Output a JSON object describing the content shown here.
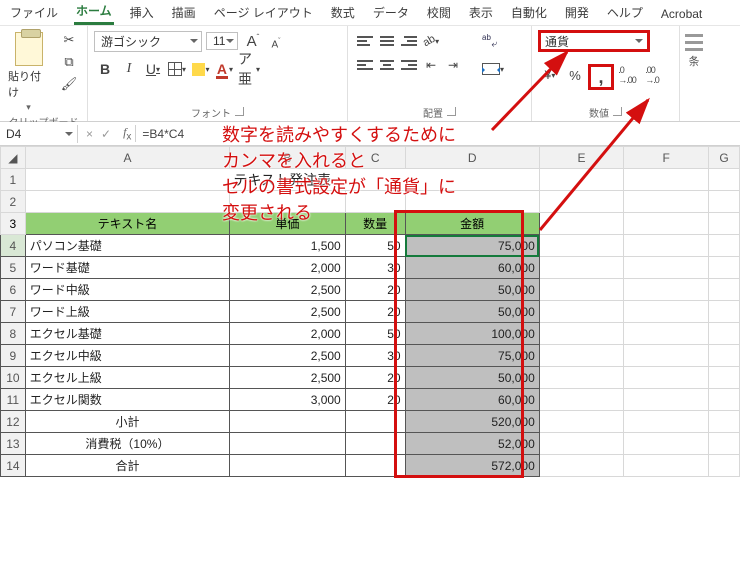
{
  "menubar": {
    "items": [
      "ファイル",
      "ホーム",
      "挿入",
      "描画",
      "ページ レイアウト",
      "数式",
      "データ",
      "校閲",
      "表示",
      "自動化",
      "開発",
      "ヘルプ",
      "Acrobat"
    ],
    "active": 1
  },
  "ribbon": {
    "clipboard": {
      "paste": "貼り付け",
      "group": "クリップボード"
    },
    "font": {
      "name": "游ゴシック",
      "size": "11",
      "group": "フォント"
    },
    "alignment": {
      "group": "配置"
    },
    "number": {
      "format": "通貨",
      "group": "数値"
    },
    "styles": {
      "group": "条"
    }
  },
  "fxbar": {
    "namebox": "D4",
    "formula": "=B4*C4"
  },
  "annotation": {
    "l1": "数字を読みやすくするために",
    "l2": "カンマを入れると",
    "l3": "セルの書式設定が「通貨」に",
    "l4": "変更される"
  },
  "sheet": {
    "cols": [
      "A",
      "B",
      "C",
      "D",
      "E",
      "F",
      "G"
    ],
    "title": "テキスト発注表",
    "headers": {
      "a": "テキスト名",
      "b": "単価",
      "c": "数量",
      "d": "金額"
    },
    "rows": [
      {
        "n": "4",
        "a": "パソコン基礎",
        "b": "1,500",
        "c": "50",
        "d": "75,000"
      },
      {
        "n": "5",
        "a": "ワード基礎",
        "b": "2,000",
        "c": "30",
        "d": "60,000"
      },
      {
        "n": "6",
        "a": "ワード中級",
        "b": "2,500",
        "c": "20",
        "d": "50,000"
      },
      {
        "n": "7",
        "a": "ワード上級",
        "b": "2,500",
        "c": "20",
        "d": "50,000"
      },
      {
        "n": "8",
        "a": "エクセル基礎",
        "b": "2,000",
        "c": "50",
        "d": "100,000"
      },
      {
        "n": "9",
        "a": "エクセル中級",
        "b": "2,500",
        "c": "30",
        "d": "75,000"
      },
      {
        "n": "10",
        "a": "エクセル上級",
        "b": "2,500",
        "c": "20",
        "d": "50,000"
      },
      {
        "n": "11",
        "a": "エクセル関数",
        "b": "3,000",
        "c": "20",
        "d": "60,000"
      }
    ],
    "subtotal": {
      "n": "12",
      "label": "小計",
      "d": "520,000"
    },
    "tax": {
      "n": "13",
      "label": "消費税（10%）",
      "d": "52,000"
    },
    "total": {
      "n": "14",
      "label": "合計",
      "d": "572,000"
    }
  },
  "chart_data": {
    "type": "table",
    "title": "テキスト発注表",
    "columns": [
      "テキスト名",
      "単価",
      "数量",
      "金額"
    ],
    "rows": [
      [
        "パソコン基礎",
        1500,
        50,
        75000
      ],
      [
        "ワード基礎",
        2000,
        30,
        60000
      ],
      [
        "ワード中級",
        2500,
        20,
        50000
      ],
      [
        "ワード上級",
        2500,
        20,
        50000
      ],
      [
        "エクセル基礎",
        2000,
        50,
        100000
      ],
      [
        "エクセル中級",
        2500,
        30,
        75000
      ],
      [
        "エクセル上級",
        2500,
        20,
        50000
      ],
      [
        "エクセル関数",
        3000,
        20,
        60000
      ]
    ],
    "subtotal": 520000,
    "tax_10pct": 52000,
    "total": 572000
  }
}
